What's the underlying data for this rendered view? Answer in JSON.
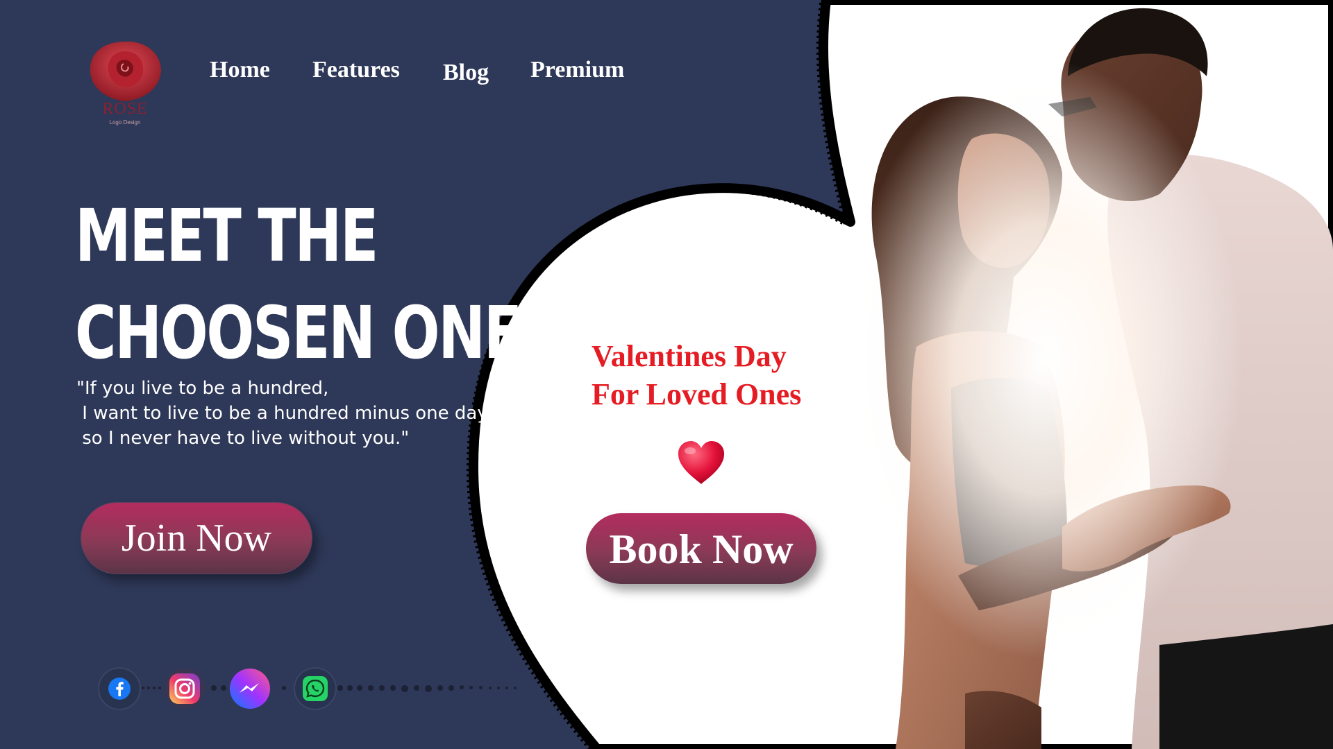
{
  "brand": {
    "logo_text": "ROSE",
    "logo_subtext": "Logo Design"
  },
  "nav": {
    "items": [
      {
        "label": "Home"
      },
      {
        "label": "Features"
      },
      {
        "label": "Blog"
      },
      {
        "label": "Premium"
      }
    ]
  },
  "hero": {
    "title_line1": "MEET THE",
    "title_line2": "CHOOSEN ONE",
    "quote": "\"If you live to be a hundred,\n I want to live to be a hundred minus one day,\n so I never have to live without you.\"",
    "join_label": "Join Now"
  },
  "promo": {
    "title": "Valentines Day\nFor Loved Ones",
    "book_label": "Book Now",
    "heart_icon": "heart-icon"
  },
  "social": {
    "icons": [
      "facebook-icon",
      "instagram-icon",
      "messenger-icon",
      "whatsapp-icon"
    ]
  },
  "colors": {
    "background": "#2e3858",
    "accent_red": "#e51c23",
    "button_top": "#b32c5e",
    "button_bottom": "#5b3446"
  }
}
